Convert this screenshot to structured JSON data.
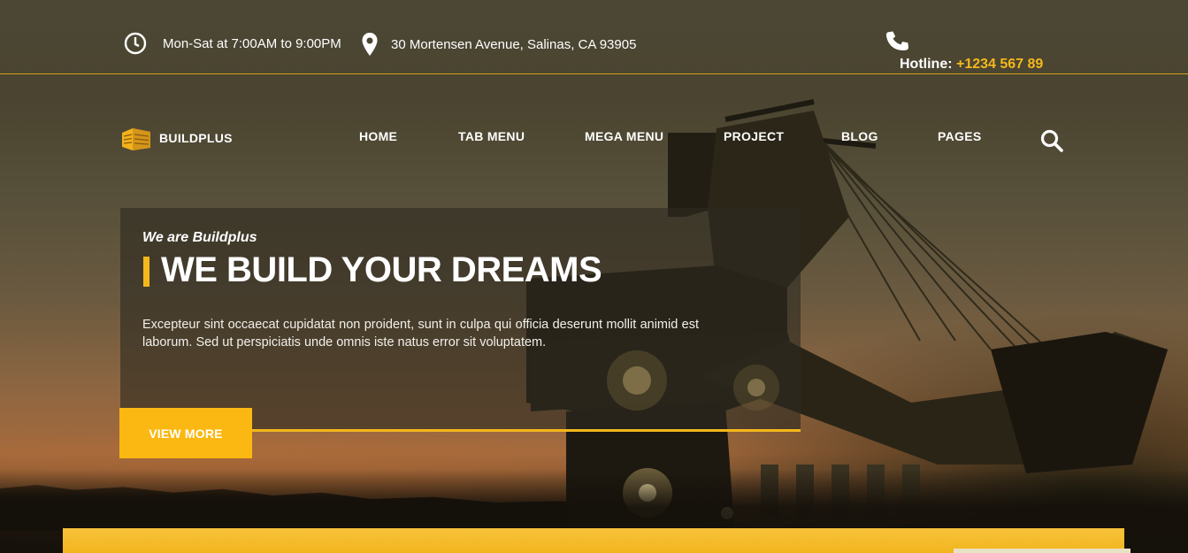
{
  "topbar": {
    "hours": "Mon-Sat at 7:00AM to 9:00PM",
    "address": "30 Mortensen Avenue, Salinas, CA 93905",
    "hotline_label": "Hotline:",
    "hotline_number": "+1234 567 89",
    "icons": [
      "clock-icon",
      "map-pin-icon",
      "phone-icon"
    ]
  },
  "logo": {
    "text": "BUILDPLUS",
    "icon": "building-logo-icon"
  },
  "nav": {
    "items": [
      "HOME",
      "TAB MENU",
      "MEGA MENU",
      "PROJECT",
      "BLOG",
      "PAGES"
    ],
    "search_icon": "search-icon"
  },
  "hero": {
    "subtitle": "We are Buildplus",
    "title": "WE BUILD YOUR DREAMS",
    "text": "Excepteur sint occaecat cupidatat non proident, sunt in culpa qui officia deserunt mollit animid est laborum. Sed ut perspiciatis unde omnis iste natus error sit voluptatem.",
    "button": "VIEW MORE"
  },
  "colors": {
    "accent": "#f4b81c",
    "button": "#fbb812"
  }
}
